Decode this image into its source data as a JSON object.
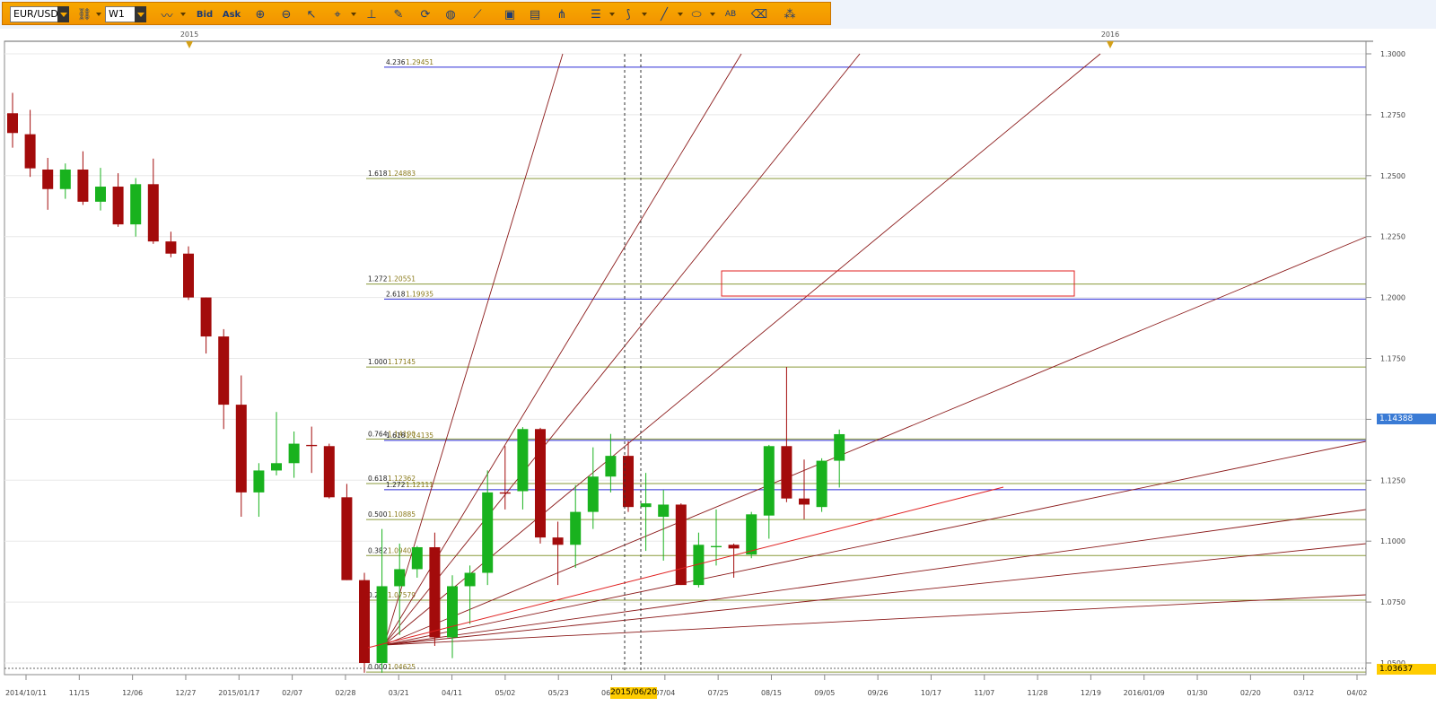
{
  "toolbar": {
    "symbol": "EUR/USD",
    "timeframe": "W1",
    "bid_label": "Bid",
    "ask_label": "Ask",
    "icons": [
      "link-icon",
      "line-chart-icon",
      "zoom-in-icon",
      "zoom-out-icon",
      "cursor-icon",
      "crosshair-icon",
      "period-separator-icon",
      "note-icon",
      "refresh-icon",
      "globe-icon",
      "ruler-icon",
      "picture-icon",
      "indicator-window-icon",
      "pitchfork-icon",
      "horizontal-lines-icon",
      "gann-fan-icon",
      "trendline-icon",
      "ellipse-icon",
      "text-label-icon",
      "eraser-icon",
      "network-icon"
    ]
  },
  "chart_data": {
    "type": "candlestick",
    "symbol": "EUR/USD",
    "timeframe": "W1",
    "ylim": [
      1.0425,
      1.3
    ],
    "y_ticks": [
      "1.3000",
      "1.2750",
      "1.2500",
      "1.2250",
      "1.2000",
      "1.1750",
      "1.1500",
      "1.1250",
      "1.1000",
      "1.0750",
      "1.0500"
    ],
    "x_ticks": [
      "2014/10/11",
      "11/15",
      "12/06",
      "12/27",
      "2015/01/17",
      "02/07",
      "02/28",
      "03/21",
      "04/11",
      "05/02",
      "05/23",
      "06/13",
      "07/04",
      "07/25",
      "08/15",
      "09/05",
      "09/26",
      "10/17",
      "11/07",
      "11/28",
      "12/19",
      "2016/01/09",
      "01/30",
      "02/20",
      "03/12",
      "04/02"
    ],
    "top_markers": [
      "2015",
      "2016"
    ],
    "current_price": "1.14388",
    "bottom_price": "1.03637",
    "highlight_date": "2015/06/20",
    "candles": [
      {
        "o": 1.2756,
        "h": 1.284,
        "l": 1.2615,
        "c": 1.2675
      },
      {
        "o": 1.267,
        "h": 1.277,
        "l": 1.2495,
        "c": 1.253
      },
      {
        "o": 1.2525,
        "h": 1.2573,
        "l": 1.236,
        "c": 1.2445
      },
      {
        "o": 1.2445,
        "h": 1.255,
        "l": 1.2405,
        "c": 1.2525
      },
      {
        "o": 1.2525,
        "h": 1.26,
        "l": 1.238,
        "c": 1.2393
      },
      {
        "o": 1.2393,
        "h": 1.2532,
        "l": 1.2357,
        "c": 1.2455
      },
      {
        "o": 1.2455,
        "h": 1.251,
        "l": 1.229,
        "c": 1.23
      },
      {
        "o": 1.23,
        "h": 1.249,
        "l": 1.225,
        "c": 1.2465
      },
      {
        "o": 1.2465,
        "h": 1.257,
        "l": 1.222,
        "c": 1.223
      },
      {
        "o": 1.223,
        "h": 1.227,
        "l": 1.2165,
        "c": 1.218
      },
      {
        "o": 1.218,
        "h": 1.221,
        "l": 1.199,
        "c": 1.2
      },
      {
        "o": 1.2,
        "h": 1.2,
        "l": 1.177,
        "c": 1.184
      },
      {
        "o": 1.184,
        "h": 1.187,
        "l": 1.146,
        "c": 1.156
      },
      {
        "o": 1.156,
        "h": 1.168,
        "l": 1.11,
        "c": 1.12
      },
      {
        "o": 1.12,
        "h": 1.132,
        "l": 1.11,
        "c": 1.129
      },
      {
        "o": 1.129,
        "h": 1.153,
        "l": 1.127,
        "c": 1.132
      },
      {
        "o": 1.132,
        "h": 1.145,
        "l": 1.126,
        "c": 1.14
      },
      {
        "o": 1.1395,
        "h": 1.147,
        "l": 1.128,
        "c": 1.139
      },
      {
        "o": 1.139,
        "h": 1.14,
        "l": 1.1175,
        "c": 1.118
      },
      {
        "o": 1.118,
        "h": 1.1235,
        "l": 1.084,
        "c": 1.084
      },
      {
        "o": 1.084,
        "h": 1.087,
        "l": 1.046,
        "c": 1.05
      },
      {
        "o": 1.05,
        "h": 1.105,
        "l": 1.046,
        "c": 1.0815
      },
      {
        "o": 1.0815,
        "h": 1.099,
        "l": 1.0615,
        "c": 1.0885
      },
      {
        "o": 1.0885,
        "h": 1.098,
        "l": 1.085,
        "c": 1.0975
      },
      {
        "o": 1.0975,
        "h": 1.1035,
        "l": 1.057,
        "c": 1.0605
      },
      {
        "o": 1.0605,
        "h": 1.086,
        "l": 1.052,
        "c": 1.0815
      },
      {
        "o": 1.0815,
        "h": 1.09,
        "l": 1.066,
        "c": 1.087
      },
      {
        "o": 1.087,
        "h": 1.129,
        "l": 1.082,
        "c": 1.12
      },
      {
        "o": 1.12,
        "h": 1.139,
        "l": 1.113,
        "c": 1.1195
      },
      {
        "o": 1.1205,
        "h": 1.1468,
        "l": 1.113,
        "c": 1.146
      },
      {
        "o": 1.146,
        "h": 1.1465,
        "l": 1.099,
        "c": 1.1015
      },
      {
        "o": 1.1015,
        "h": 1.108,
        "l": 1.082,
        "c": 1.0985
      },
      {
        "o": 1.0985,
        "h": 1.123,
        "l": 1.089,
        "c": 1.112
      },
      {
        "o": 1.112,
        "h": 1.1385,
        "l": 1.105,
        "c": 1.1265
      },
      {
        "o": 1.1265,
        "h": 1.144,
        "l": 1.12,
        "c": 1.135
      },
      {
        "o": 1.135,
        "h": 1.141,
        "l": 1.112,
        "c": 1.114
      },
      {
        "o": 1.114,
        "h": 1.128,
        "l": 1.096,
        "c": 1.1155
      },
      {
        "o": 1.11,
        "h": 1.121,
        "l": 1.092,
        "c": 1.115
      },
      {
        "o": 1.115,
        "h": 1.1155,
        "l": 1.082,
        "c": 1.082
      },
      {
        "o": 1.082,
        "h": 1.1035,
        "l": 1.081,
        "c": 1.0985
      },
      {
        "o": 1.0975,
        "h": 1.113,
        "l": 1.09,
        "c": 1.098
      },
      {
        "o": 1.0985,
        "h": 1.099,
        "l": 1.085,
        "c": 1.097
      },
      {
        "o": 1.0945,
        "h": 1.112,
        "l": 1.093,
        "c": 1.111
      },
      {
        "o": 1.1105,
        "h": 1.1395,
        "l": 1.101,
        "c": 1.139
      },
      {
        "o": 1.139,
        "h": 1.1715,
        "l": 1.116,
        "c": 1.1175
      },
      {
        "o": 1.1175,
        "h": 1.1335,
        "l": 1.109,
        "c": 1.115
      },
      {
        "o": 1.114,
        "h": 1.134,
        "l": 1.112,
        "c": 1.133
      },
      {
        "o": 1.133,
        "h": 1.1458,
        "l": 1.122,
        "c": 1.1439
      }
    ],
    "fib_levels": [
      {
        "ratio": "4.236",
        "price": "1.29451",
        "value": 1.29451,
        "color": "#2b2bd6",
        "series": "ext"
      },
      {
        "ratio": "1.618",
        "price": "1.24883",
        "value": 1.24883,
        "color": "#8a9a3a",
        "series": "ret"
      },
      {
        "ratio": "1.272",
        "price": "1.20551",
        "value": 1.20551,
        "color": "#8a9a3a",
        "series": "ret"
      },
      {
        "ratio": "2.618",
        "price": "1.19935",
        "value": 1.19935,
        "color": "#2b2bd6",
        "series": "ext"
      },
      {
        "ratio": "1.000",
        "price": "1.17145",
        "value": 1.17145,
        "color": "#8a9a3a",
        "series": "ret"
      },
      {
        "ratio": "0.764",
        "price": "1.14190",
        "value": 1.1419,
        "color": "#8a9a3a",
        "series": "ret"
      },
      {
        "ratio": "1.618",
        "price": "1.14135",
        "value": 1.14135,
        "color": "#2b2bd6",
        "series": "ext"
      },
      {
        "ratio": "0.618",
        "price": "1.12362",
        "value": 1.12362,
        "color": "#8a9a3a",
        "series": "ret"
      },
      {
        "ratio": "1.272",
        "price": "1.12111",
        "value": 1.12111,
        "color": "#2b2bd6",
        "series": "ext"
      },
      {
        "ratio": "0.500",
        "price": "1.10885",
        "value": 1.10885,
        "color": "#8a9a3a",
        "series": "ret"
      },
      {
        "ratio": "0.382",
        "price": "1.09407",
        "value": 1.09407,
        "color": "#8a9a3a",
        "series": "ret"
      },
      {
        "ratio": "0.236",
        "price": "1.07579",
        "value": 1.07579,
        "color": "#8a9a3a",
        "series": "ret"
      },
      {
        "ratio": "0.000",
        "price": "1.04625",
        "value": 1.04625,
        "color": "#8a9a3a",
        "series": "ret"
      }
    ],
    "colors": {
      "bull": "#19b21e",
      "bear": "#a30b0b",
      "grid": "#e8e8e8",
      "fan": "#8b1a1a",
      "box": "#e02020",
      "axis": "#555555"
    }
  }
}
